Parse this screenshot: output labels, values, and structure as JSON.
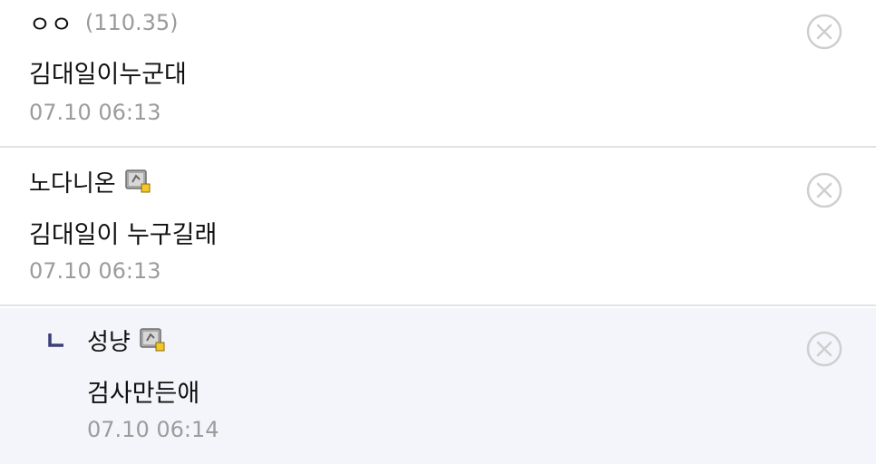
{
  "comments": [
    {
      "author": "ㅇㅇ",
      "ip": "(110.35)",
      "text": "김대일이누군대",
      "date": "07.10 06:13",
      "delete_icon": "close-circle-icon"
    },
    {
      "author": "노다니온",
      "member_icon": "fixed-nick-icon",
      "text": "김대일이 누구길래",
      "date": "07.10 06:13",
      "delete_icon": "close-circle-icon"
    },
    {
      "author": "성냥",
      "member_icon": "fixed-nick-icon",
      "text": "검사만든애",
      "date": "07.10 06:14",
      "is_reply": true,
      "reply_icon": "reply-arrow-icon",
      "delete_icon": "close-circle-icon"
    }
  ],
  "colors": {
    "text": "#111111",
    "meta": "#9c9c9c",
    "divider": "#e3e3e6",
    "reply_bg": "#f4f5fa",
    "reply_mark": "#3a3f7a",
    "delete_icon": "#cfcfcf"
  }
}
